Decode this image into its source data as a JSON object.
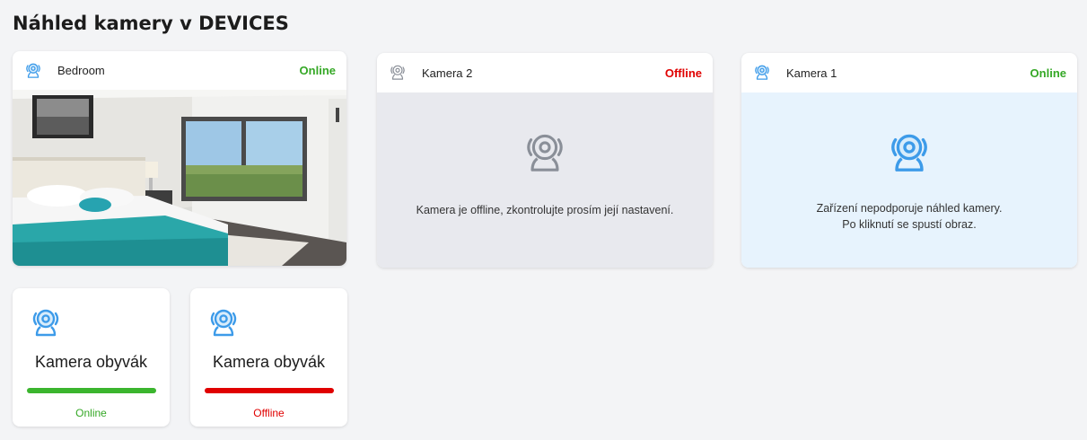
{
  "page": {
    "title": "Náhled kamery v DEVICES"
  },
  "colors": {
    "online": "#35a826",
    "offline": "#e00000",
    "icon_blue": "#3d9be9",
    "icon_gray": "#8a8f98"
  },
  "cards": [
    {
      "name": "Bedroom",
      "status": "Online",
      "icon": "webcam-icon",
      "preview": "bedroom-photo"
    },
    {
      "name": "Kamera 2",
      "status": "Offline",
      "icon": "webcam-icon",
      "message": "Kamera je offline, zkontrolujte prosím její nastavení."
    },
    {
      "name": "Kamera 1",
      "status": "Online",
      "icon": "webcam-icon",
      "message_line1": "Zařízení nepodporuje náhled kamery.",
      "message_line2": "Po kliknutí se spustí obraz."
    }
  ],
  "tiles": [
    {
      "name": "Kamera obyvák",
      "status": "Online",
      "icon": "webcam-icon"
    },
    {
      "name": "Kamera obyvák",
      "status": "Offline",
      "icon": "webcam-icon"
    }
  ]
}
